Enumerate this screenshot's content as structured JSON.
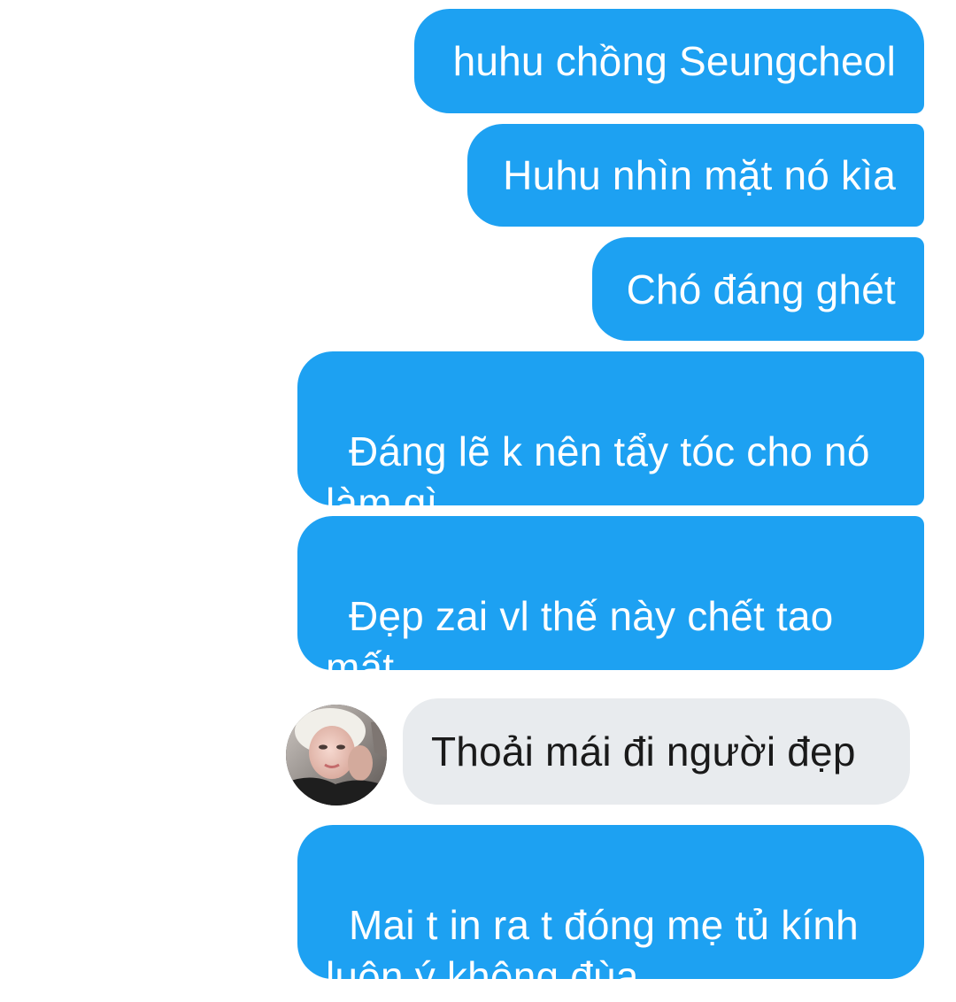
{
  "conversation": {
    "messages": [
      {
        "sender": "me",
        "text": "huhu chồng Seungcheol"
      },
      {
        "sender": "me",
        "text": "Huhu nhìn mặt nó kìa"
      },
      {
        "sender": "me",
        "text": "Chó đáng ghét"
      },
      {
        "sender": "me",
        "text": "Đáng lẽ k nên tẩy tóc cho nó\nlàm gì"
      },
      {
        "sender": "me",
        "text": "Đẹp zai vl thế này chết tao\nmất"
      },
      {
        "sender": "them",
        "text": "Thoải mái đi người đẹp",
        "avatar": "user-avatar-photo"
      },
      {
        "sender": "me",
        "text": "Mai t in ra t đóng mẹ tủ kính\nluôn ý không đùa"
      }
    ]
  },
  "colors": {
    "outgoing_bubble": "#1da1f2",
    "incoming_bubble": "#e8ebee",
    "background": "#ffffff"
  }
}
